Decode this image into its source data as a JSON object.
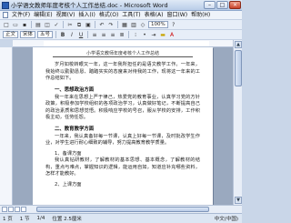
{
  "window": {
    "title": "小学语文教师年度考核个人工作总结.doc - Microsoft Word",
    "buttons": {
      "minimize": "–",
      "maximize": "□",
      "close": "×"
    }
  },
  "menu": {
    "items": [
      "文件(F)",
      "编辑(E)",
      "视图(V)",
      "插入(I)",
      "格式(O)",
      "工具(T)",
      "表格(A)",
      "窗口(W)",
      "帮助(H)"
    ]
  },
  "toolbar": {
    "zoom": "100%",
    "style": "正文",
    "font": "宋体",
    "size": "五号"
  },
  "document": {
    "header": "小学语文教师年度考核个人工作总结",
    "intro": "岁月如梭转眼又一年，这一年我所担任的是语文教学工作。一年来，我始终以勤勤恳恳、踏踏实实的态度来对待我的工作，现将这一年来的工作总结如下。",
    "section1_title": "一、思想政治方面",
    "section1_text": "我一年来在思想上严于律己，热爱党的教育事业，认真学习党的方针政策，积极参加学校组织的各项政治学习，认真做好笔记，不断提高自己的政治素质和思想觉悟。积极响应学校的号召，服从学校的安排，工作积极主动，任劳任怨。",
    "section2_title": "二、教育教学方面",
    "section2_text": "一年来，我认真备好每一节课，认真上好每一节课，及时批改学生作业，对学生进行耐心细致的辅导，努力提高教育教学质量。",
    "item1": "1、备课方面",
    "item1_text": "我认真钻研教材，了解教材的基本思想、基本概念，了解教材的结构，重点与难点，掌握知识的逻辑，能运用自如，知道应补充哪些资料，怎样才能教好。",
    "item2": "2、上课方面"
  },
  "status": {
    "page": "1 页",
    "section": "1 节",
    "page_of": "1/4",
    "position": "位置 2.5厘米",
    "language": "中文(中国)"
  }
}
